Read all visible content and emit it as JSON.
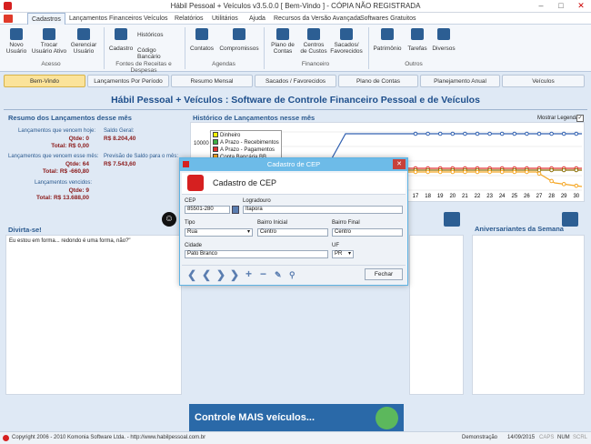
{
  "app": {
    "title": "Hábil Pessoal + Veículos v3.5.0.0 [ Bem-Vindo ] - CÓPIA NÃO REGISTRADA"
  },
  "menu": [
    "Cadastros",
    "Lançamentos Financeiros",
    "Veículos",
    "Relatórios",
    "Utilitários",
    "Ajuda",
    "Recursos da Versão Avançada",
    "Softwares Gratuitos"
  ],
  "ribbon": {
    "acesso": {
      "novo": "Novo Usuário",
      "trocar": "Trocar Usuário Ativo",
      "gerenciar": "Gerenciar Usuário",
      "group": "Acesso"
    },
    "fontes": {
      "cadastro": "Cadastro",
      "historicos": "Históricos",
      "codigo": "Código Bancário",
      "group": "Fontes de Receitas e Despesas"
    },
    "agendas": {
      "contatos": "Contatos",
      "compromissos": "Compromissos",
      "group": "Agendas"
    },
    "financeiro": {
      "plano": "Plano de Contas",
      "centros": "Centros de Custos",
      "sacados": "Sacados/ Favorecidos",
      "group": "Financeiro"
    },
    "outros": {
      "patrimonio": "Patrimônio",
      "tarefas": "Tarefas",
      "diversos": "Diversos",
      "group": "Outros"
    }
  },
  "tabs": [
    "Bem-Vindo",
    "Lançamentos Por Período",
    "Resumo Mensal",
    "Sacados / Favorecidos",
    "Plano de Contas",
    "Planejamento Anual",
    "Veículos"
  ],
  "heading": "Hábil Pessoal + Veículos : Software de Controle Financeiro Pessoal e de Veículos",
  "resumo": {
    "title": "Resumo dos Lançamentos desse mês",
    "hoje_label": "Lançamentos que vencem hoje:",
    "hoje_qtde": "Qtde: 0",
    "hoje_total": "Total: R$ 0,00",
    "mes_label": "Lançamentos que vencem esse mês:",
    "mes_qtde": "Qtde: 64",
    "mes_total": "Total: R$ -660,80",
    "venc_label": "Lançamentos vencidos:",
    "venc_qtde": "Qtde: 9",
    "venc_total": "Total: R$ 13.688,00",
    "saldo_label": "Saldo Geral:",
    "saldo_val": "R$ 8.204,40",
    "prev_label": "Previsão de Saldo para o mês:",
    "prev_val": "R$ 7.543,60"
  },
  "historico": {
    "title": "Histórico de Lançamentos nesse mês",
    "mostrar": "Mostrar Legenda",
    "check": "✓",
    "ytick": "10000"
  },
  "chart_data": {
    "type": "line",
    "title": "Histórico de Lançamentos nesse mês",
    "x_visible": [
      17,
      18,
      19,
      20,
      21,
      22,
      23,
      24,
      25,
      26,
      27,
      28,
      29,
      30
    ],
    "series": [
      {
        "name": "Dinheiro",
        "color": "#f2f200"
      },
      {
        "name": "A Prazo - Recebimentos",
        "color": "#3cb043"
      },
      {
        "name": "A Prazo - Pagamentos",
        "color": "#e03030"
      },
      {
        "name": "Conta Bancária BB",
        "color": "#f5a623"
      }
    ]
  },
  "divirta": {
    "title": "Divirta-se!",
    "text": "Eu estou em forma... redondo é uma forma, não?\""
  },
  "aniversariantes": {
    "title": "Aniversariantes da Semana"
  },
  "dialog": {
    "title": "Cadastro de CEP",
    "header": "Cadastro de CEP",
    "cep_label": "CEP",
    "cep": "85501-280",
    "log_label": "Logradouro",
    "log": "Itapora",
    "tipo_label": "Tipo",
    "tipo": "Rua",
    "bi_label": "Bairro Inicial",
    "bi": "Centro",
    "bf_label": "Bairro Final",
    "bf": "Centro",
    "cidade_label": "Cidade",
    "cidade": "Pato Branco",
    "uf_label": "UF",
    "uf": "PR",
    "fechar": "Fechar"
  },
  "banner": {
    "text": "Controle MAIS veículos..."
  },
  "status": {
    "copyright": "Copyright 2006 - 2010 Komonia Software Ltda. - http://www.habilpessoal.com.br",
    "mode": "Demonstração",
    "date": "14/09/2015",
    "caps": "CAPS",
    "num": "NUM",
    "scrl": "SCRL"
  }
}
